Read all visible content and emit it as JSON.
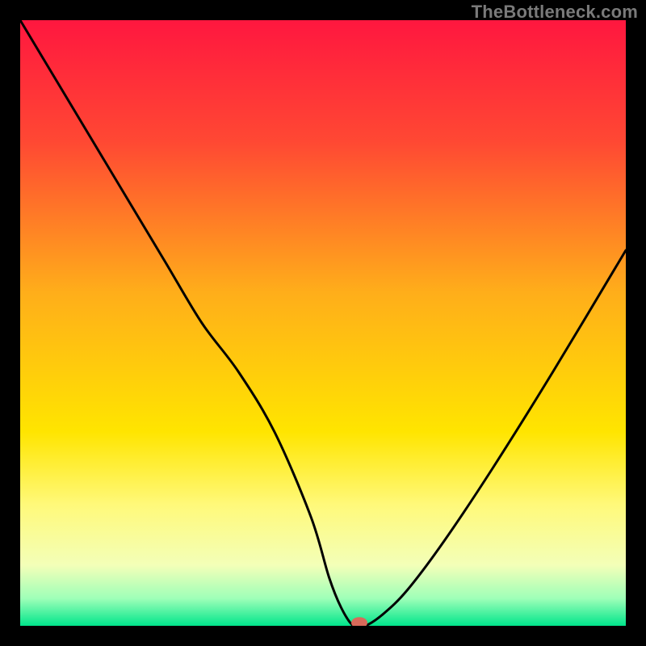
{
  "watermark": "TheBottleneck.com",
  "chart_data": {
    "type": "line",
    "title": "",
    "xlabel": "",
    "ylabel": "",
    "x_range": [
      0,
      100
    ],
    "y_range": [
      0,
      100
    ],
    "gradient": [
      {
        "offset": 0.0,
        "color": "#ff173f"
      },
      {
        "offset": 0.2,
        "color": "#ff4833"
      },
      {
        "offset": 0.45,
        "color": "#ffae1a"
      },
      {
        "offset": 0.68,
        "color": "#ffe500"
      },
      {
        "offset": 0.8,
        "color": "#fff97a"
      },
      {
        "offset": 0.9,
        "color": "#f3ffb8"
      },
      {
        "offset": 0.955,
        "color": "#9effb8"
      },
      {
        "offset": 1.0,
        "color": "#00e58b"
      }
    ],
    "series": [
      {
        "name": "bottleneck",
        "x": [
          0,
          6,
          12,
          18,
          24,
          30,
          36,
          42,
          48,
          51,
          53,
          55,
          57,
          60,
          64,
          70,
          78,
          88,
          100
        ],
        "values": [
          100,
          90,
          80,
          70,
          60,
          50,
          42,
          32,
          18,
          8,
          3,
          0,
          0,
          2,
          6,
          14,
          26,
          42,
          62
        ]
      }
    ],
    "marker": {
      "x": 56,
      "y": 0.5,
      "color": "#d86a5a"
    }
  }
}
